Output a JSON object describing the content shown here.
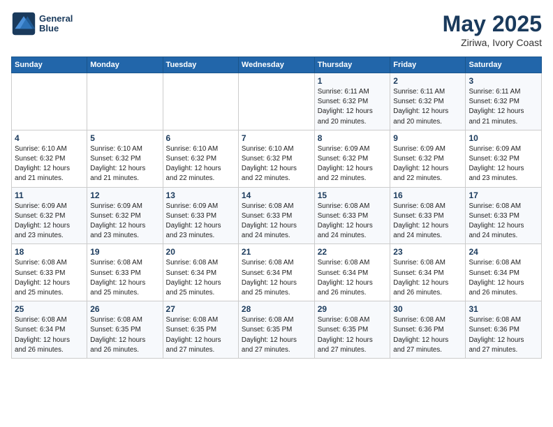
{
  "header": {
    "logo_line1": "General",
    "logo_line2": "Blue",
    "month_year": "May 2025",
    "location": "Ziriwa, Ivory Coast"
  },
  "weekdays": [
    "Sunday",
    "Monday",
    "Tuesday",
    "Wednesday",
    "Thursday",
    "Friday",
    "Saturday"
  ],
  "weeks": [
    [
      {
        "day": "",
        "info": ""
      },
      {
        "day": "",
        "info": ""
      },
      {
        "day": "",
        "info": ""
      },
      {
        "day": "",
        "info": ""
      },
      {
        "day": "1",
        "info": "Sunrise: 6:11 AM\nSunset: 6:32 PM\nDaylight: 12 hours\nand 20 minutes."
      },
      {
        "day": "2",
        "info": "Sunrise: 6:11 AM\nSunset: 6:32 PM\nDaylight: 12 hours\nand 20 minutes."
      },
      {
        "day": "3",
        "info": "Sunrise: 6:11 AM\nSunset: 6:32 PM\nDaylight: 12 hours\nand 21 minutes."
      }
    ],
    [
      {
        "day": "4",
        "info": "Sunrise: 6:10 AM\nSunset: 6:32 PM\nDaylight: 12 hours\nand 21 minutes."
      },
      {
        "day": "5",
        "info": "Sunrise: 6:10 AM\nSunset: 6:32 PM\nDaylight: 12 hours\nand 21 minutes."
      },
      {
        "day": "6",
        "info": "Sunrise: 6:10 AM\nSunset: 6:32 PM\nDaylight: 12 hours\nand 22 minutes."
      },
      {
        "day": "7",
        "info": "Sunrise: 6:10 AM\nSunset: 6:32 PM\nDaylight: 12 hours\nand 22 minutes."
      },
      {
        "day": "8",
        "info": "Sunrise: 6:09 AM\nSunset: 6:32 PM\nDaylight: 12 hours\nand 22 minutes."
      },
      {
        "day": "9",
        "info": "Sunrise: 6:09 AM\nSunset: 6:32 PM\nDaylight: 12 hours\nand 22 minutes."
      },
      {
        "day": "10",
        "info": "Sunrise: 6:09 AM\nSunset: 6:32 PM\nDaylight: 12 hours\nand 23 minutes."
      }
    ],
    [
      {
        "day": "11",
        "info": "Sunrise: 6:09 AM\nSunset: 6:32 PM\nDaylight: 12 hours\nand 23 minutes."
      },
      {
        "day": "12",
        "info": "Sunrise: 6:09 AM\nSunset: 6:32 PM\nDaylight: 12 hours\nand 23 minutes."
      },
      {
        "day": "13",
        "info": "Sunrise: 6:09 AM\nSunset: 6:33 PM\nDaylight: 12 hours\nand 23 minutes."
      },
      {
        "day": "14",
        "info": "Sunrise: 6:08 AM\nSunset: 6:33 PM\nDaylight: 12 hours\nand 24 minutes."
      },
      {
        "day": "15",
        "info": "Sunrise: 6:08 AM\nSunset: 6:33 PM\nDaylight: 12 hours\nand 24 minutes."
      },
      {
        "day": "16",
        "info": "Sunrise: 6:08 AM\nSunset: 6:33 PM\nDaylight: 12 hours\nand 24 minutes."
      },
      {
        "day": "17",
        "info": "Sunrise: 6:08 AM\nSunset: 6:33 PM\nDaylight: 12 hours\nand 24 minutes."
      }
    ],
    [
      {
        "day": "18",
        "info": "Sunrise: 6:08 AM\nSunset: 6:33 PM\nDaylight: 12 hours\nand 25 minutes."
      },
      {
        "day": "19",
        "info": "Sunrise: 6:08 AM\nSunset: 6:33 PM\nDaylight: 12 hours\nand 25 minutes."
      },
      {
        "day": "20",
        "info": "Sunrise: 6:08 AM\nSunset: 6:34 PM\nDaylight: 12 hours\nand 25 minutes."
      },
      {
        "day": "21",
        "info": "Sunrise: 6:08 AM\nSunset: 6:34 PM\nDaylight: 12 hours\nand 25 minutes."
      },
      {
        "day": "22",
        "info": "Sunrise: 6:08 AM\nSunset: 6:34 PM\nDaylight: 12 hours\nand 26 minutes."
      },
      {
        "day": "23",
        "info": "Sunrise: 6:08 AM\nSunset: 6:34 PM\nDaylight: 12 hours\nand 26 minutes."
      },
      {
        "day": "24",
        "info": "Sunrise: 6:08 AM\nSunset: 6:34 PM\nDaylight: 12 hours\nand 26 minutes."
      }
    ],
    [
      {
        "day": "25",
        "info": "Sunrise: 6:08 AM\nSunset: 6:34 PM\nDaylight: 12 hours\nand 26 minutes."
      },
      {
        "day": "26",
        "info": "Sunrise: 6:08 AM\nSunset: 6:35 PM\nDaylight: 12 hours\nand 26 minutes."
      },
      {
        "day": "27",
        "info": "Sunrise: 6:08 AM\nSunset: 6:35 PM\nDaylight: 12 hours\nand 27 minutes."
      },
      {
        "day": "28",
        "info": "Sunrise: 6:08 AM\nSunset: 6:35 PM\nDaylight: 12 hours\nand 27 minutes."
      },
      {
        "day": "29",
        "info": "Sunrise: 6:08 AM\nSunset: 6:35 PM\nDaylight: 12 hours\nand 27 minutes."
      },
      {
        "day": "30",
        "info": "Sunrise: 6:08 AM\nSunset: 6:36 PM\nDaylight: 12 hours\nand 27 minutes."
      },
      {
        "day": "31",
        "info": "Sunrise: 6:08 AM\nSunset: 6:36 PM\nDaylight: 12 hours\nand 27 minutes."
      }
    ]
  ]
}
